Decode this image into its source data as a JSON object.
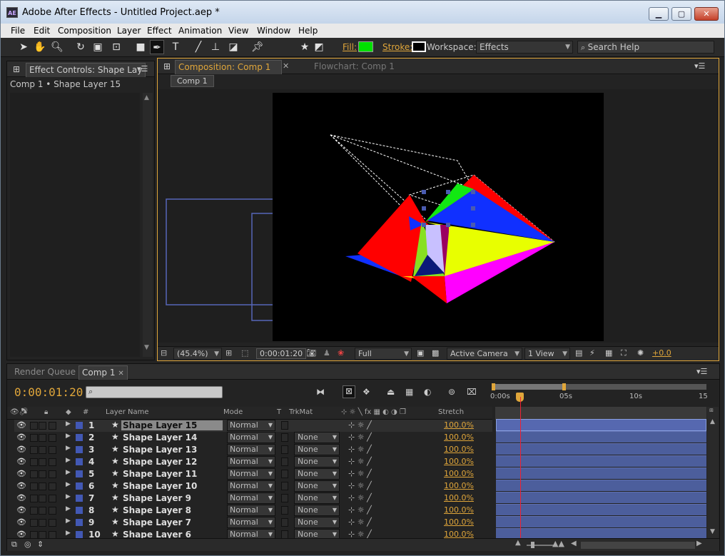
{
  "window": {
    "title": "Adobe After Effects - Untitled Project.aep *",
    "app_icon": "AE",
    "controls": [
      "minimize",
      "maximize",
      "close"
    ]
  },
  "menu": [
    "File",
    "Edit",
    "Composition",
    "Layer",
    "Effect",
    "Animation",
    "View",
    "Window",
    "Help"
  ],
  "toolbar": {
    "fill_label": "Fill:",
    "fill_color": "#00e000",
    "stroke_label": "Stroke:",
    "workspace_label": "Workspace:",
    "workspace_value": "Effects",
    "search_placeholder": "Search Help"
  },
  "effect_controls": {
    "tab": "Effect Controls: Shape Lay",
    "breadcrumb": "Comp 1 • Shape Layer 15"
  },
  "composition": {
    "tab": "Composition: Comp 1",
    "flowchart_tab": "Flowchart: Comp 1",
    "comp_button": "Comp 1",
    "zoom": "(45.4%)",
    "timecode": "0:00:01:20",
    "resolution": "Full",
    "camera": "Active Camera",
    "views": "1 View",
    "exposure": "+0.0"
  },
  "timeline": {
    "render_tab": "Render Queue",
    "comp_tab": "Comp 1",
    "timecode": "0:00:01:20",
    "ruler": [
      "0:00s",
      "05s",
      "10s",
      "15"
    ],
    "headers": {
      "num": "#",
      "layer_name": "Layer Name",
      "mode": "Mode",
      "t": "T",
      "trkmat": "TrkMat",
      "stretch": "Stretch"
    },
    "layers": [
      {
        "num": "1",
        "name": "Shape Layer 15",
        "mode": "Normal",
        "trkmat": "",
        "stretch": "100.0%"
      },
      {
        "num": "2",
        "name": "Shape Layer 14",
        "mode": "Normal",
        "trkmat": "None",
        "stretch": "100.0%"
      },
      {
        "num": "3",
        "name": "Shape Layer 13",
        "mode": "Normal",
        "trkmat": "None",
        "stretch": "100.0%"
      },
      {
        "num": "4",
        "name": "Shape Layer 12",
        "mode": "Normal",
        "trkmat": "None",
        "stretch": "100.0%"
      },
      {
        "num": "5",
        "name": "Shape Layer 11",
        "mode": "Normal",
        "trkmat": "None",
        "stretch": "100.0%"
      },
      {
        "num": "6",
        "name": "Shape Layer 10",
        "mode": "Normal",
        "trkmat": "None",
        "stretch": "100.0%"
      },
      {
        "num": "7",
        "name": "Shape Layer 9",
        "mode": "Normal",
        "trkmat": "None",
        "stretch": "100.0%"
      },
      {
        "num": "8",
        "name": "Shape Layer 8",
        "mode": "Normal",
        "trkmat": "None",
        "stretch": "100.0%"
      },
      {
        "num": "9",
        "name": "Shape Layer 7",
        "mode": "Normal",
        "trkmat": "None",
        "stretch": "100.0%"
      },
      {
        "num": "10",
        "name": "Shape Layer 6",
        "mode": "Normal",
        "trkmat": "None",
        "stretch": "100.0%"
      }
    ]
  }
}
